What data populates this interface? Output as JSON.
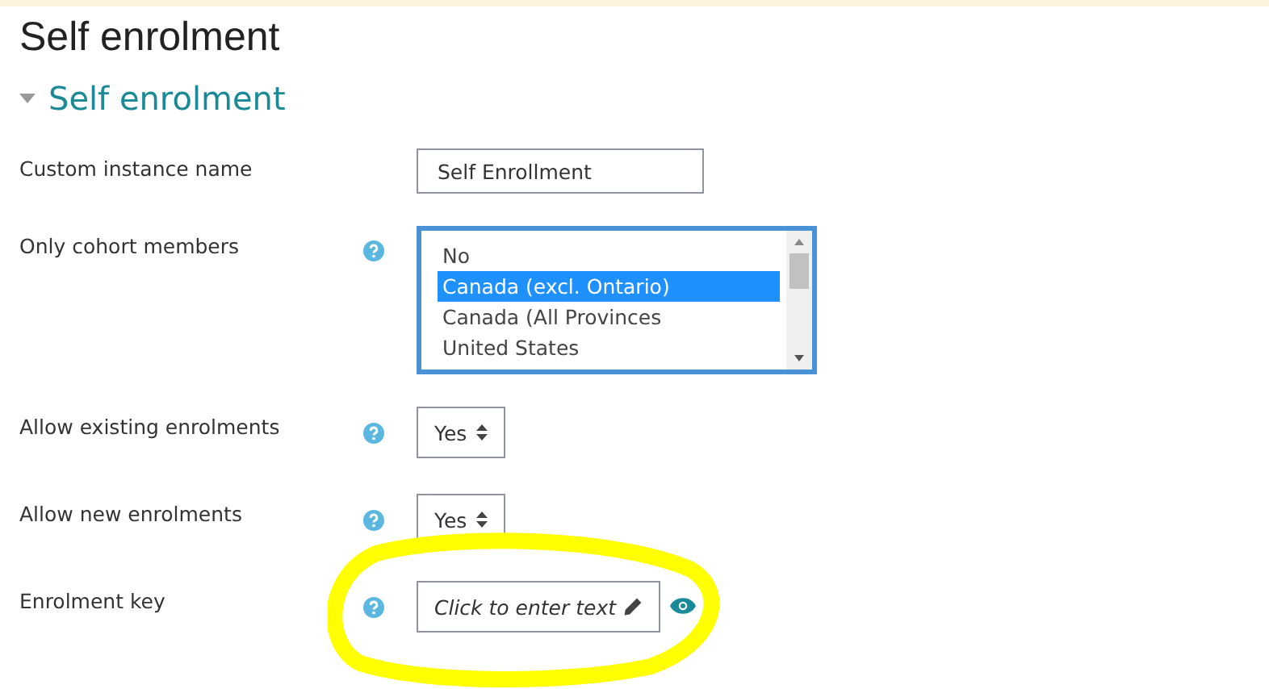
{
  "page_title": "Self enrolment",
  "section": {
    "title": "Self enrolment",
    "expanded": true
  },
  "fields": [
    {
      "kind": "text",
      "label": "Custom instance name",
      "help": false,
      "value": "Self Enrollment"
    },
    {
      "kind": "list",
      "label": "Only cohort members",
      "help": true,
      "options": [
        {
          "label": "No",
          "selected": false
        },
        {
          "label": "Canada (excl. Ontario)",
          "selected": true
        },
        {
          "label": "Canada (All Provinces",
          "selected": false
        },
        {
          "label": "United States",
          "selected": false
        }
      ]
    },
    {
      "kind": "select",
      "label": "Allow existing enrolments",
      "help": true,
      "value": "Yes"
    },
    {
      "kind": "select",
      "label": "Allow new enrolments",
      "help": true,
      "value": "Yes"
    },
    {
      "kind": "inplace",
      "label": "Enrolment key",
      "help": true,
      "placeholder": "Click to enter text"
    }
  ],
  "annotation": {
    "kind": "highlight-circle"
  }
}
